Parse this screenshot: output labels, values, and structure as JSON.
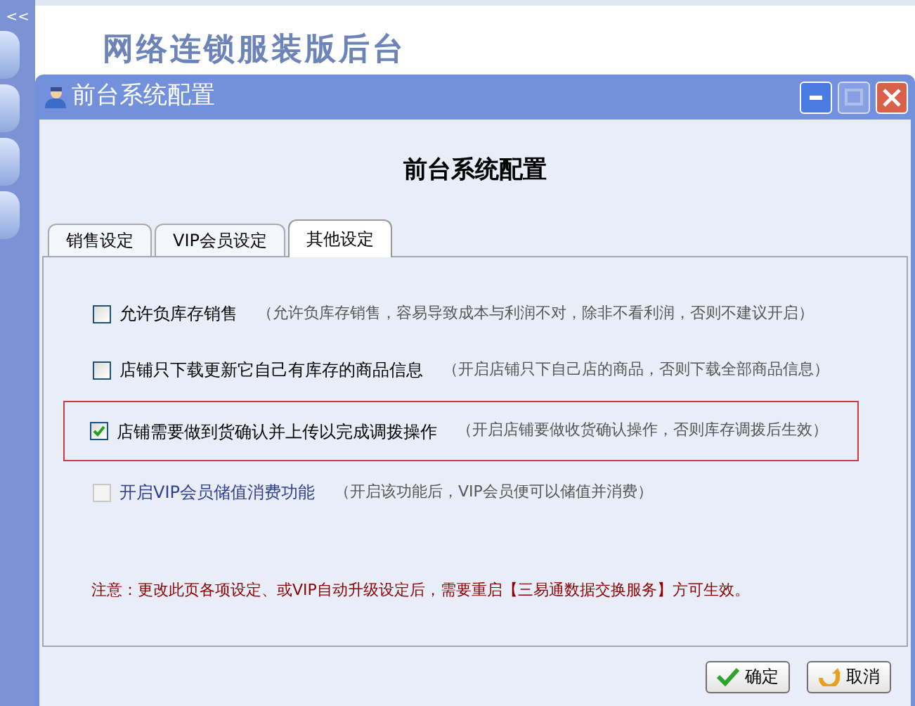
{
  "sidebar": {
    "collapse_label": "<<"
  },
  "page_title": "网络连锁服装版后台",
  "window": {
    "title": "前台系统配置",
    "buttons": [
      {
        "kind": "minimize",
        "disabled": false
      },
      {
        "kind": "maximize",
        "disabled": true
      },
      {
        "kind": "close",
        "disabled": false
      }
    ]
  },
  "heading": "前台系统配置",
  "tabs": [
    {
      "label": "销售设定",
      "selected": false
    },
    {
      "label": "VIP会员设定",
      "selected": false
    },
    {
      "label": "其他设定",
      "selected": true
    }
  ],
  "options": [
    {
      "label": "允许负库存销售",
      "hint": "（允许负库存销售，容易导致成本与利润不对，除非不看利润，否则不建议开启）",
      "checked": false,
      "disabled": false,
      "highlighted": false
    },
    {
      "label": "店铺只下载更新它自己有库存的商品信息",
      "hint": "（开启店铺只下自己店的商品，否则下载全部商品信息）",
      "checked": false,
      "disabled": false,
      "highlighted": false
    },
    {
      "label": "店铺需要做到货确认并上传以完成调拨操作",
      "hint": "（开启店铺要做收货确认操作，否则库存调拨后生效）",
      "checked": true,
      "disabled": false,
      "highlighted": true
    },
    {
      "label": "开启VIP会员储值消费功能",
      "hint": "（开启该功能后，VIP会员便可以储值并消费）",
      "checked": false,
      "disabled": true,
      "highlighted": false
    }
  ],
  "notice": "注意：更改此页各项设定、或VIP自动升级设定后，需要重启【三易通数据交换服务】方可生效。",
  "buttons": [
    {
      "kind": "ok",
      "label": "确定"
    },
    {
      "kind": "cancel",
      "label": "取消"
    }
  ]
}
